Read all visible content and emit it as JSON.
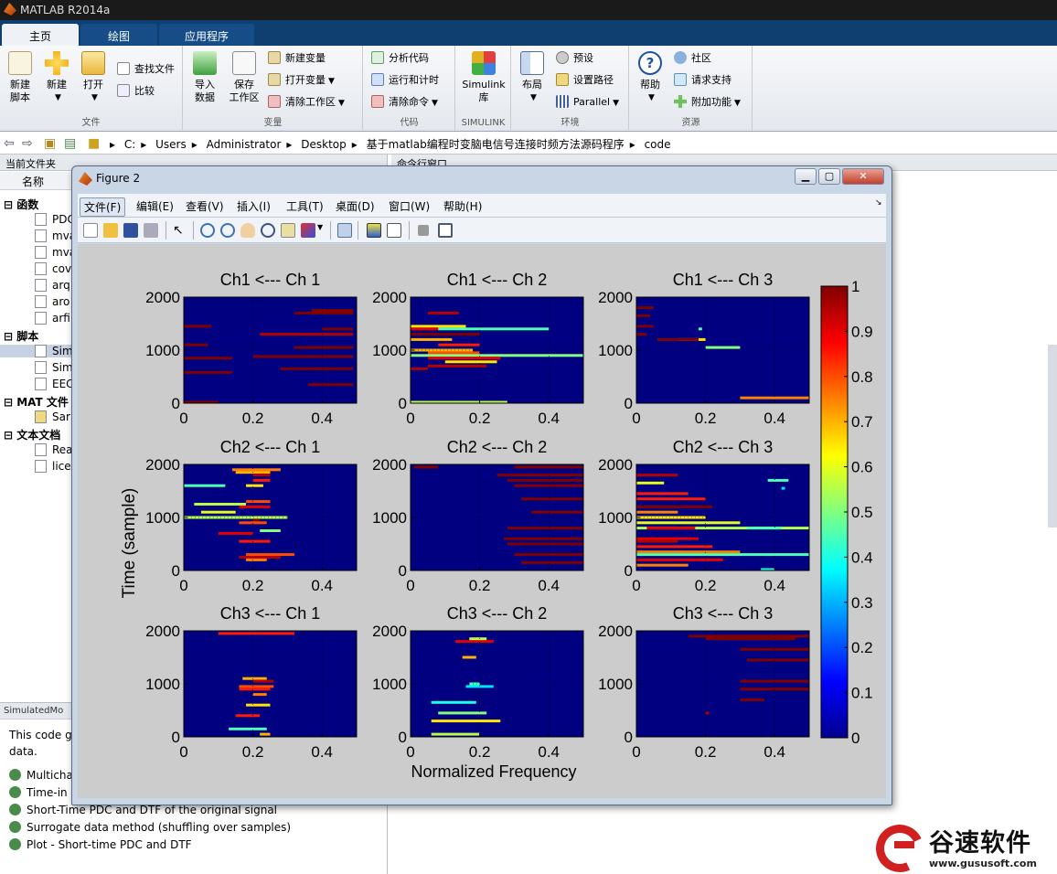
{
  "app": {
    "title": "MATLAB R2014a"
  },
  "tabs": [
    {
      "label": "主页"
    },
    {
      "label": "绘图"
    },
    {
      "label": "应用程序"
    }
  ],
  "ribbon": {
    "file": {
      "label": "文件",
      "new_script": "新建\n脚本",
      "new": "新建",
      "open": "打开",
      "find_files": "查找文件",
      "compare": "比较"
    },
    "variable": {
      "label": "变量",
      "import": "导入\n数据",
      "save_ws": "保存\n工作区",
      "new_var": "新建变量",
      "open_var": "打开变量",
      "clear_ws": "清除工作区"
    },
    "code": {
      "label": "代码",
      "analyze": "分析代码",
      "run_time": "运行和计时",
      "clear_cmd": "清除命令"
    },
    "simulink": {
      "label": "SIMULINK",
      "lib": "Simulink\n库"
    },
    "env": {
      "label": "环境",
      "layout": "布局",
      "prefs": "预设",
      "set_path": "设置路径",
      "parallel": "Parallel"
    },
    "resources": {
      "label": "资源",
      "help": "帮助",
      "community": "社区",
      "support": "请求支持",
      "addons": "附加功能"
    }
  },
  "address": {
    "parts": [
      "C:",
      "Users",
      "Administrator",
      "Desktop",
      "基于matlab编程时变脑电信号连接时频方法源码程序",
      "code"
    ]
  },
  "current_folder": {
    "title": "当前文件夹",
    "col_name": "名称",
    "groups": [
      {
        "label": "函数",
        "items": [
          "PDC",
          "mva",
          "mva",
          "cov",
          "arq",
          "aro",
          "arfi"
        ]
      },
      {
        "label": "脚本",
        "items": [
          "Sim",
          "Sim",
          "EEC"
        ]
      },
      {
        "label": "MAT 文件",
        "items": [
          "Sar"
        ]
      },
      {
        "label": "文本文档",
        "items": [
          "Rea",
          "lice"
        ]
      }
    ],
    "detail_header": "SimulatedMo",
    "detail_text": "This code g",
    "detail_text2": "data.",
    "links": [
      "Multicha",
      "Time-in",
      "Short-Time  PDC and DTF of the original signal",
      "Surrogate data method (shuffling over samples)",
      "Plot - Short-time PDC and DTF"
    ]
  },
  "command_window": {
    "title": "命令行窗口"
  },
  "figure": {
    "title": "Figure 2",
    "menu": [
      "文件(F)",
      "编辑(E)",
      "查看(V)",
      "插入(I)",
      "工具(T)",
      "桌面(D)",
      "窗口(W)",
      "帮助(H)"
    ]
  },
  "chart_data": {
    "type": "heatmap",
    "subplot_titles": [
      "Ch1 <--- Ch 1",
      "Ch1 <--- Ch 2",
      "Ch1 <--- Ch 3",
      "Ch2 <--- Ch 1",
      "Ch2 <--- Ch 2",
      "Ch2 <--- Ch 3",
      "Ch3 <--- Ch 1",
      "Ch3 <--- Ch 2",
      "Ch3 <--- Ch 3"
    ],
    "xlabel": "Normalized Frequency",
    "ylabel": "Time (sample)",
    "xlim": [
      0,
      0.5
    ],
    "ylim": [
      0,
      2000
    ],
    "xticks": [
      "0",
      "0.2",
      "0.4"
    ],
    "yticks": [
      "0",
      "1000",
      "2000"
    ],
    "colormap": "jet",
    "clim": [
      0,
      1
    ],
    "colorbar_ticks": [
      "0",
      "0.1",
      "0.2",
      "0.3",
      "0.4",
      "0.5",
      "0.6",
      "0.7",
      "0.8",
      "0.9",
      "1"
    ],
    "background_value": 0,
    "segments": [
      [
        [
          0.37,
          0.49,
          1750,
          1.0
        ],
        [
          0.32,
          0.49,
          1700,
          1.0
        ],
        [
          0.4,
          0.49,
          1400,
          1.0
        ],
        [
          0.0,
          0.07,
          1100,
          1.0
        ],
        [
          0.32,
          0.49,
          1050,
          1.0
        ],
        [
          0.28,
          0.49,
          650,
          1.0
        ],
        [
          0.0,
          0.14,
          580,
          1.0
        ],
        [
          0.36,
          0.49,
          350,
          1.0
        ],
        [
          0.0,
          0.1,
          0,
          1.0
        ],
        [
          0.22,
          0.49,
          1300,
          0.95
        ],
        [
          0.0,
          0.14,
          850,
          1.0
        ],
        [
          0.2,
          0.49,
          880,
          1.0
        ],
        [
          0.0,
          0.08,
          1450,
          1.0
        ]
      ],
      [
        [
          0.0,
          0.16,
          1450,
          0.65
        ],
        [
          0.0,
          0.08,
          1400,
          0.9
        ],
        [
          0.08,
          0.4,
          1400,
          0.45
        ],
        [
          0.0,
          0.2,
          1300,
          1.0
        ],
        [
          0.0,
          0.12,
          1200,
          0.7
        ],
        [
          0.08,
          0.2,
          1100,
          0.85
        ],
        [
          0.0,
          0.18,
          1000,
          0.7
        ],
        [
          0.05,
          0.2,
          950,
          0.8
        ],
        [
          0.0,
          0.5,
          900,
          0.5
        ],
        [
          0.05,
          0.26,
          850,
          0.9
        ],
        [
          0.1,
          0.25,
          780,
          0.65
        ],
        [
          0.05,
          0.22,
          700,
          0.95
        ],
        [
          0.0,
          0.28,
          0,
          0.55
        ],
        [
          0.05,
          0.14,
          1700,
          0.95
        ],
        [
          0.0,
          0.05,
          650,
          0.95
        ]
      ],
      [
        [
          0.0,
          0.05,
          1800,
          1.0
        ],
        [
          0.0,
          0.04,
          1650,
          1.0
        ],
        [
          0.0,
          0.05,
          1450,
          1.0
        ],
        [
          0.0,
          0.03,
          1300,
          1.0
        ],
        [
          0.12,
          0.2,
          1200,
          0.65
        ],
        [
          0.06,
          0.18,
          1200,
          1.0
        ],
        [
          0.2,
          0.3,
          1050,
          0.5
        ],
        [
          0.3,
          0.5,
          100,
          0.75
        ],
        [
          0.18,
          0.19,
          1400,
          0.45
        ]
      ],
      [
        [
          0.14,
          0.28,
          1900,
          0.75
        ],
        [
          0.15,
          0.25,
          1850,
          0.7
        ],
        [
          0.2,
          0.25,
          1800,
          0.95
        ],
        [
          0.2,
          0.25,
          1700,
          0.85
        ],
        [
          0.18,
          0.23,
          1600,
          0.65
        ],
        [
          0.03,
          0.18,
          1250,
          0.55
        ],
        [
          0.18,
          0.25,
          1300,
          0.8
        ],
        [
          0.16,
          0.25,
          1200,
          0.9
        ],
        [
          0.05,
          0.15,
          1100,
          0.6
        ],
        [
          0.18,
          0.28,
          1000,
          0.75
        ],
        [
          0.0,
          0.3,
          1000,
          0.55
        ],
        [
          0.2,
          0.22,
          950,
          1.0
        ],
        [
          0.16,
          0.24,
          900,
          0.8
        ],
        [
          0.22,
          0.28,
          750,
          0.5
        ],
        [
          0.1,
          0.2,
          700,
          0.9
        ],
        [
          0.16,
          0.25,
          550,
          0.85
        ],
        [
          0.18,
          0.32,
          300,
          0.8
        ],
        [
          0.16,
          0.28,
          250,
          0.95
        ],
        [
          0.18,
          0.24,
          200,
          0.75
        ],
        [
          0.0,
          0.12,
          1600,
          0.45
        ]
      ],
      [
        [
          0.3,
          0.5,
          1950,
          1.0
        ],
        [
          0.01,
          0.08,
          1950,
          1.0
        ],
        [
          0.25,
          0.5,
          1800,
          1.0
        ],
        [
          0.28,
          0.5,
          1700,
          1.0
        ],
        [
          0.3,
          0.5,
          1600,
          1.0
        ],
        [
          0.32,
          0.5,
          1350,
          1.0
        ],
        [
          0.35,
          0.5,
          1100,
          1.0
        ],
        [
          0.28,
          0.5,
          800,
          1.0
        ],
        [
          0.27,
          0.5,
          600,
          1.0
        ],
        [
          0.28,
          0.5,
          500,
          1.0
        ],
        [
          0.3,
          0.5,
          300,
          1.0
        ],
        [
          0.32,
          0.5,
          150,
          1.0
        ]
      ],
      [
        [
          0.0,
          0.12,
          1800,
          0.95
        ],
        [
          0.0,
          0.08,
          1650,
          0.6
        ],
        [
          0.0,
          0.15,
          1450,
          0.85
        ],
        [
          0.0,
          0.2,
          1350,
          0.85
        ],
        [
          0.0,
          0.22,
          1200,
          1.0
        ],
        [
          0.0,
          0.12,
          1100,
          0.75
        ],
        [
          0.0,
          0.2,
          1000,
          0.65
        ],
        [
          0.0,
          0.3,
          900,
          0.6
        ],
        [
          0.0,
          0.5,
          800,
          0.55
        ],
        [
          0.03,
          0.17,
          800,
          0.9
        ],
        [
          0.32,
          0.42,
          800,
          0.45
        ],
        [
          0.0,
          0.18,
          600,
          0.9
        ],
        [
          0.0,
          0.12,
          550,
          0.95
        ],
        [
          0.0,
          0.22,
          450,
          0.85
        ],
        [
          0.0,
          0.3,
          350,
          0.75
        ],
        [
          0.0,
          0.5,
          300,
          0.45
        ],
        [
          0.0,
          0.25,
          200,
          0.9
        ],
        [
          0.0,
          0.15,
          100,
          0.75
        ],
        [
          0.38,
          0.44,
          1700,
          0.45
        ],
        [
          0.42,
          0.43,
          1550,
          0.35
        ],
        [
          0.36,
          0.4,
          0,
          0.4
        ]
      ],
      [
        [
          0.17,
          0.24,
          1100,
          0.7
        ],
        [
          0.2,
          0.26,
          1050,
          0.95
        ],
        [
          0.16,
          0.26,
          950,
          0.8
        ],
        [
          0.16,
          0.25,
          900,
          0.85
        ],
        [
          0.2,
          0.24,
          800,
          0.75
        ],
        [
          0.18,
          0.25,
          600,
          0.65
        ],
        [
          0.15,
          0.22,
          400,
          0.85
        ],
        [
          0.13,
          0.24,
          150,
          0.45
        ],
        [
          0.22,
          0.25,
          50,
          0.7
        ],
        [
          0.1,
          0.32,
          1950,
          0.85
        ]
      ],
      [
        [
          0.13,
          0.24,
          1800,
          0.9
        ],
        [
          0.15,
          0.19,
          1500,
          0.7
        ],
        [
          0.17,
          0.2,
          1000,
          0.45
        ],
        [
          0.16,
          0.24,
          950,
          0.35
        ],
        [
          0.06,
          0.19,
          650,
          0.4
        ],
        [
          0.08,
          0.22,
          450,
          0.5
        ],
        [
          0.06,
          0.26,
          300,
          0.65
        ],
        [
          0.06,
          0.2,
          50,
          0.55
        ],
        [
          0.17,
          0.22,
          1850,
          0.55
        ]
      ],
      [
        [
          0.15,
          0.5,
          1900,
          1.0
        ],
        [
          0.2,
          0.46,
          1850,
          1.0
        ],
        [
          0.3,
          0.5,
          1650,
          1.0
        ],
        [
          0.32,
          0.5,
          1450,
          1.0
        ],
        [
          0.3,
          0.5,
          1050,
          1.0
        ],
        [
          0.3,
          0.5,
          900,
          1.0
        ],
        [
          0.3,
          0.37,
          700,
          1.0
        ],
        [
          0.2,
          0.21,
          450,
          0.95
        ]
      ]
    ]
  }
}
